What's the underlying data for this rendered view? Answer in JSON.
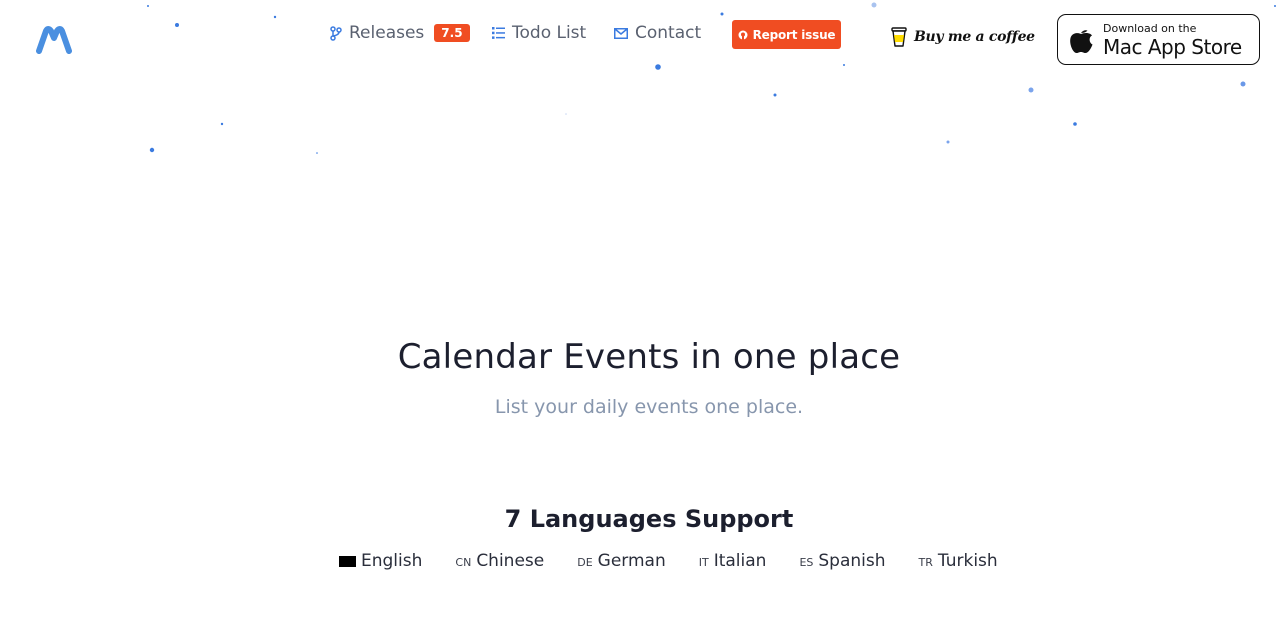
{
  "header": {
    "logo_icon": "m-logo-icon",
    "nav": {
      "releases": {
        "icon": "branch-icon",
        "label": "Releases",
        "badge": "7.5"
      },
      "todo": {
        "icon": "list-icon",
        "label": "Todo List"
      },
      "contact": {
        "icon": "mail-icon",
        "label": "Contact"
      }
    },
    "report": {
      "icon": "github-icon",
      "label": "Report issue"
    },
    "coffee": {
      "icon": "coffee-cup-icon",
      "label": "Buy me a coffee"
    },
    "appstore": {
      "icon": "apple-icon",
      "small": "Download on the",
      "big": "Mac App Store"
    }
  },
  "hero": {
    "title": "Calendar Events in one place",
    "subtitle": "List your daily events one place."
  },
  "languages": {
    "title": "7 Languages Support",
    "items": [
      {
        "code": "",
        "label": "English"
      },
      {
        "code": "CN",
        "label": "Chinese"
      },
      {
        "code": "DE",
        "label": "German"
      },
      {
        "code": "IT",
        "label": "Italian"
      },
      {
        "code": "ES",
        "label": "Spanish"
      },
      {
        "code": "TR",
        "label": "Turkish"
      }
    ]
  },
  "colors": {
    "accent": "#f04d22",
    "logo": "#4a8fe0",
    "dots": "#3b7be0",
    "subtitle": "#8796ad"
  }
}
